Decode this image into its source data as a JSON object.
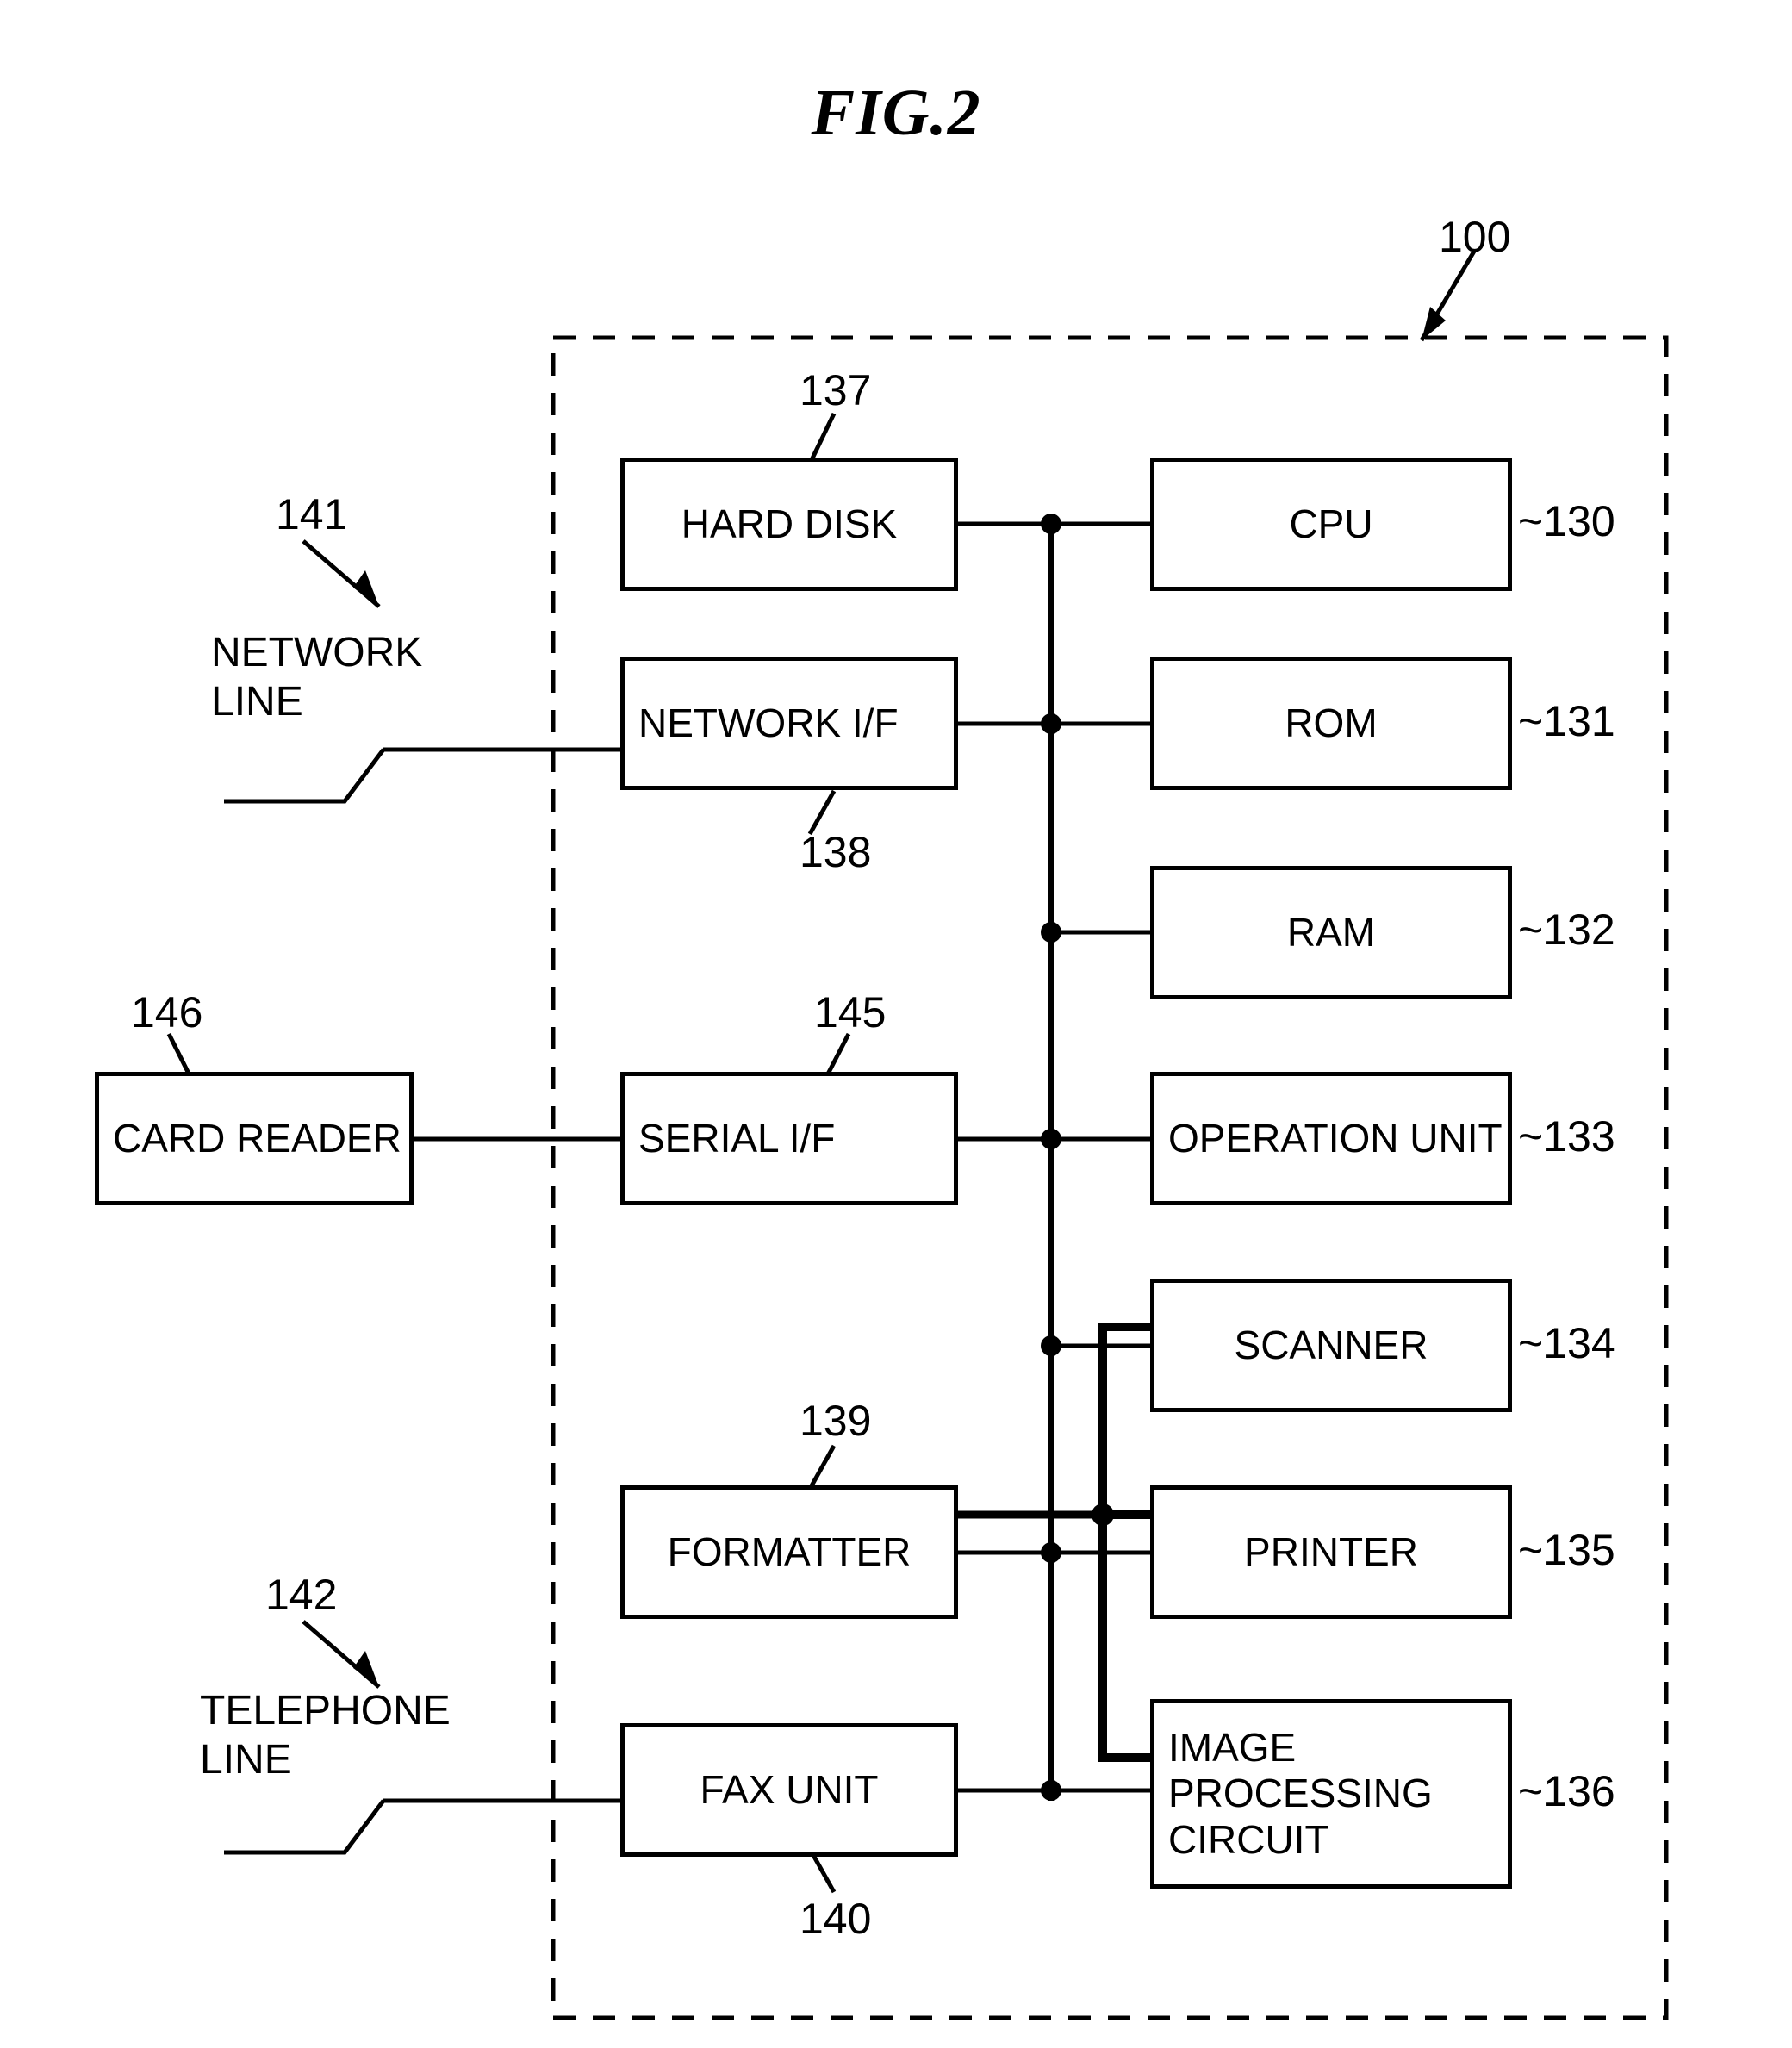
{
  "figure": {
    "title": "FIG.2",
    "device_ref": "100"
  },
  "boxes": [
    {
      "id": "hard-disk",
      "label": "HARD DISK",
      "ref": "137",
      "ref_position": "above"
    },
    {
      "id": "network-if",
      "label": "NETWORK\nI/F",
      "ref": "138",
      "ref_position": "below"
    },
    {
      "id": "serial-if",
      "label": "SERIAL\nI/F",
      "ref": "145",
      "ref_position": "above"
    },
    {
      "id": "formatter",
      "label": "FORMATTER",
      "ref": "139",
      "ref_position": "above"
    },
    {
      "id": "fax-unit",
      "label": "FAX UNIT",
      "ref": "140",
      "ref_position": "below"
    },
    {
      "id": "card-reader",
      "label": "CARD\nREADER",
      "ref": "146",
      "ref_position": "above"
    },
    {
      "id": "cpu",
      "label": "CPU",
      "ref": "130",
      "ref_position": "right"
    },
    {
      "id": "rom",
      "label": "ROM",
      "ref": "131",
      "ref_position": "right"
    },
    {
      "id": "ram",
      "label": "RAM",
      "ref": "132",
      "ref_position": "right"
    },
    {
      "id": "operation-unit",
      "label": "OPERATION\nUNIT",
      "ref": "133",
      "ref_position": "right"
    },
    {
      "id": "scanner",
      "label": "SCANNER",
      "ref": "134",
      "ref_position": "right"
    },
    {
      "id": "printer",
      "label": "PRINTER",
      "ref": "135",
      "ref_position": "right"
    },
    {
      "id": "image-proc",
      "label": "IMAGE\nPROCESSING\nCIRCUIT",
      "ref": "136",
      "ref_position": "right"
    }
  ],
  "external_labels": [
    {
      "id": "network-line",
      "label": "NETWORK\nLINE",
      "ref": "141"
    },
    {
      "id": "telephone-line",
      "label": "TELEPHONE\nLINE",
      "ref": "142"
    }
  ],
  "text": {
    "hard_disk": "HARD DISK",
    "network_if": "NETWORK\nI/F",
    "serial_if": "SERIAL\nI/F",
    "formatter": "FORMATTER",
    "fax_unit": "FAX UNIT",
    "card_reader": "CARD\nREADER",
    "cpu": "CPU",
    "rom": "ROM",
    "ram": "RAM",
    "operation_unit": "OPERATION\nUNIT",
    "scanner": "SCANNER",
    "printer": "PRINTER",
    "image_processing_circuit": "IMAGE\nPROCESSING\nCIRCUIT",
    "network_line": "NETWORK\nLINE",
    "telephone_line": "TELEPHONE\nLINE",
    "ref_100": "100",
    "ref_130": "130",
    "ref_131": "131",
    "ref_132": "132",
    "ref_133": "133",
    "ref_134": "134",
    "ref_135": "135",
    "ref_136": "136",
    "ref_137": "137",
    "ref_138": "138",
    "ref_139": "139",
    "ref_140": "140",
    "ref_141": "141",
    "ref_142": "142",
    "ref_145": "145",
    "ref_146": "146",
    "ref_130_label": "~130",
    "ref_131_label": "~131",
    "ref_132_label": "~132",
    "ref_133_label": "~133",
    "ref_134_label": "~134",
    "ref_135_label": "~135",
    "ref_136_label": "~136"
  },
  "colors": {
    "line": "#000000",
    "background": "#ffffff"
  }
}
